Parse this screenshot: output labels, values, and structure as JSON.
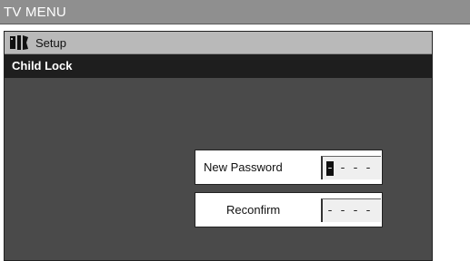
{
  "window": {
    "title": "TV MENU"
  },
  "menu": {
    "section_label": "Setup",
    "section_icon": "tools-icon",
    "current_item": "Child Lock"
  },
  "form": {
    "new_password": {
      "label": "New Password",
      "digits": [
        "-",
        "-",
        "-",
        "-"
      ],
      "cursor_index": 0
    },
    "reconfirm": {
      "label": "Reconfirm",
      "digits": [
        "-",
        "-",
        "-",
        "-"
      ]
    }
  }
}
